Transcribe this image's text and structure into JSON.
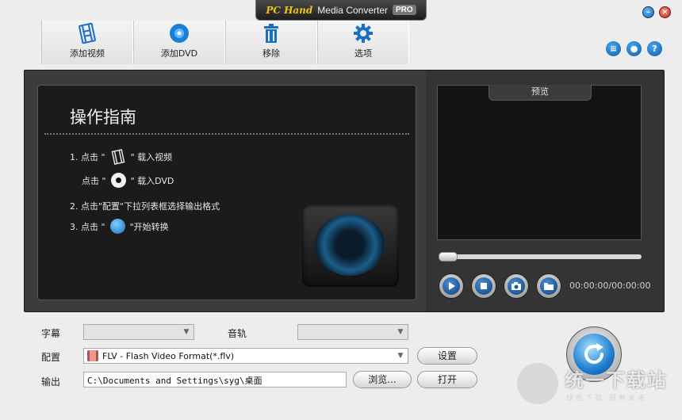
{
  "window": {
    "brand": "PC Hand",
    "app_name": "Media Converter",
    "edition": "PRO",
    "minimize_label": "–",
    "close_label": "×"
  },
  "toolbar": {
    "items": [
      {
        "label": "添加视频",
        "icon": "film-icon"
      },
      {
        "label": "添加DVD",
        "icon": "dvd-icon"
      },
      {
        "label": "移除",
        "icon": "trash-icon"
      },
      {
        "label": "选项",
        "icon": "gear-icon"
      }
    ]
  },
  "help_icons": [
    {
      "icon": "list-icon",
      "glyph": "≡"
    },
    {
      "icon": "user-icon",
      "glyph": "●"
    },
    {
      "icon": "help-icon",
      "glyph": "?"
    }
  ],
  "guide": {
    "title": "操作指南",
    "step1_prefix": "1. 点击 \"",
    "step1_suffix": "\" 载入视频",
    "step1b_prefix": "点击 \"",
    "step1b_suffix": "\" 载入DVD",
    "step2": "2. 点击\"配置\"下拉列表框选择输出格式",
    "step3_prefix": "3. 点击 \"",
    "step3_suffix": "\"开始转换"
  },
  "preview": {
    "title": "预览",
    "timecode": "00:00:00/00:00:00",
    "seek_position": 0
  },
  "form": {
    "subtitle_label": "字幕",
    "subtitle_value": "",
    "audio_label": "音轨",
    "audio_value": "",
    "profile_label": "配置",
    "profile_value": "FLV - Flash Video Format(*.flv)",
    "settings_button": "设置",
    "output_label": "输出",
    "output_path": "C:\\Documents and Settings\\syg\\桌面",
    "browse_button": "浏览...",
    "open_button": "打开"
  },
  "watermark": {
    "text": "统一下载站",
    "sub": "绿色下载 服务未来"
  }
}
